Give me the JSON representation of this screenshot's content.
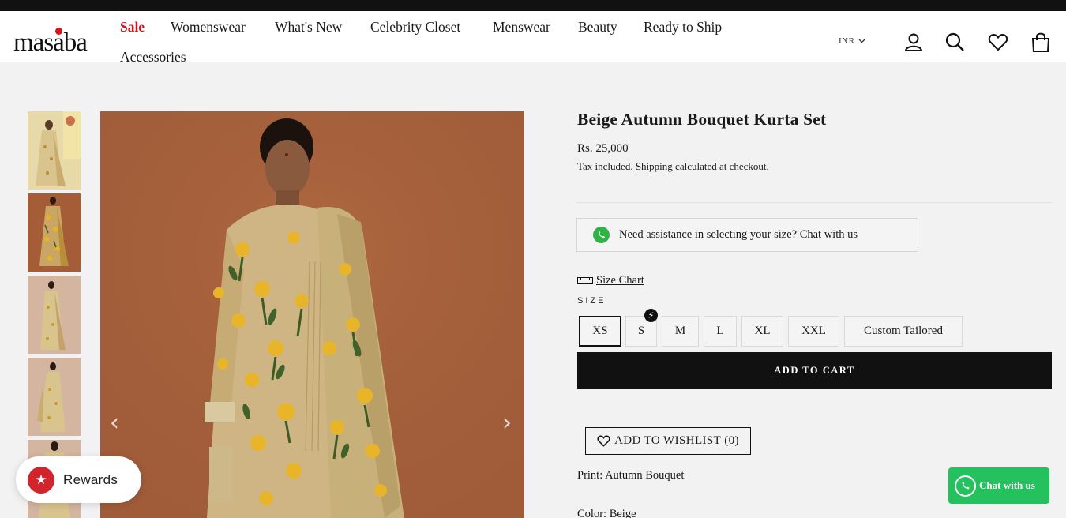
{
  "brand": {
    "logo_text": "masaba"
  },
  "nav": {
    "items": [
      {
        "label": "Sale"
      },
      {
        "label": "Womenswear"
      },
      {
        "label": "What's New"
      },
      {
        "label": "Celebrity Closet"
      },
      {
        "label": "Menswear"
      },
      {
        "label": "Beauty"
      },
      {
        "label": "Ready to Ship"
      },
      {
        "label": "Accessories"
      }
    ],
    "currency": "INR"
  },
  "header_icons": [
    "account-icon",
    "search-icon",
    "wishlist-heart-icon",
    "cart-bag-icon"
  ],
  "gallery": {
    "thumbnail_count": 5,
    "selected_index": 1,
    "prev_arrow": "‹",
    "next_arrow": "›"
  },
  "product": {
    "title": "Beige Autumn Bouquet Kurta Set",
    "price": "Rs. 25,000",
    "tax_prefix": "Tax included.",
    "tax_link": "Shipping",
    "tax_suffix": "calculated at checkout.",
    "assist_text": "Need assistance in selecting your size? Chat with us",
    "size_chart_label": "Size Chart",
    "size_heading": "SIZE",
    "sizes": [
      "XS",
      "S",
      "M",
      "L",
      "XL",
      "XXL",
      "Custom Tailored"
    ],
    "selected_size": "XS",
    "add_to_cart": "ADD TO CART",
    "wishlist_label": "ADD TO WISHLIST",
    "wishlist_count": "(0)",
    "print_label": "Print:",
    "print_value": "Autumn Bouquet",
    "color_label": "Color:",
    "color_value": "Beige"
  },
  "widgets": {
    "rewards_label": "Rewards",
    "whatsapp_label": "Chat with us"
  },
  "colors": {
    "sale_red": "#c8171c",
    "black": "#111111",
    "whatsapp_green": "#25c15e",
    "rewards_red": "#d2242c",
    "page_bg": "#f2f2f2"
  }
}
